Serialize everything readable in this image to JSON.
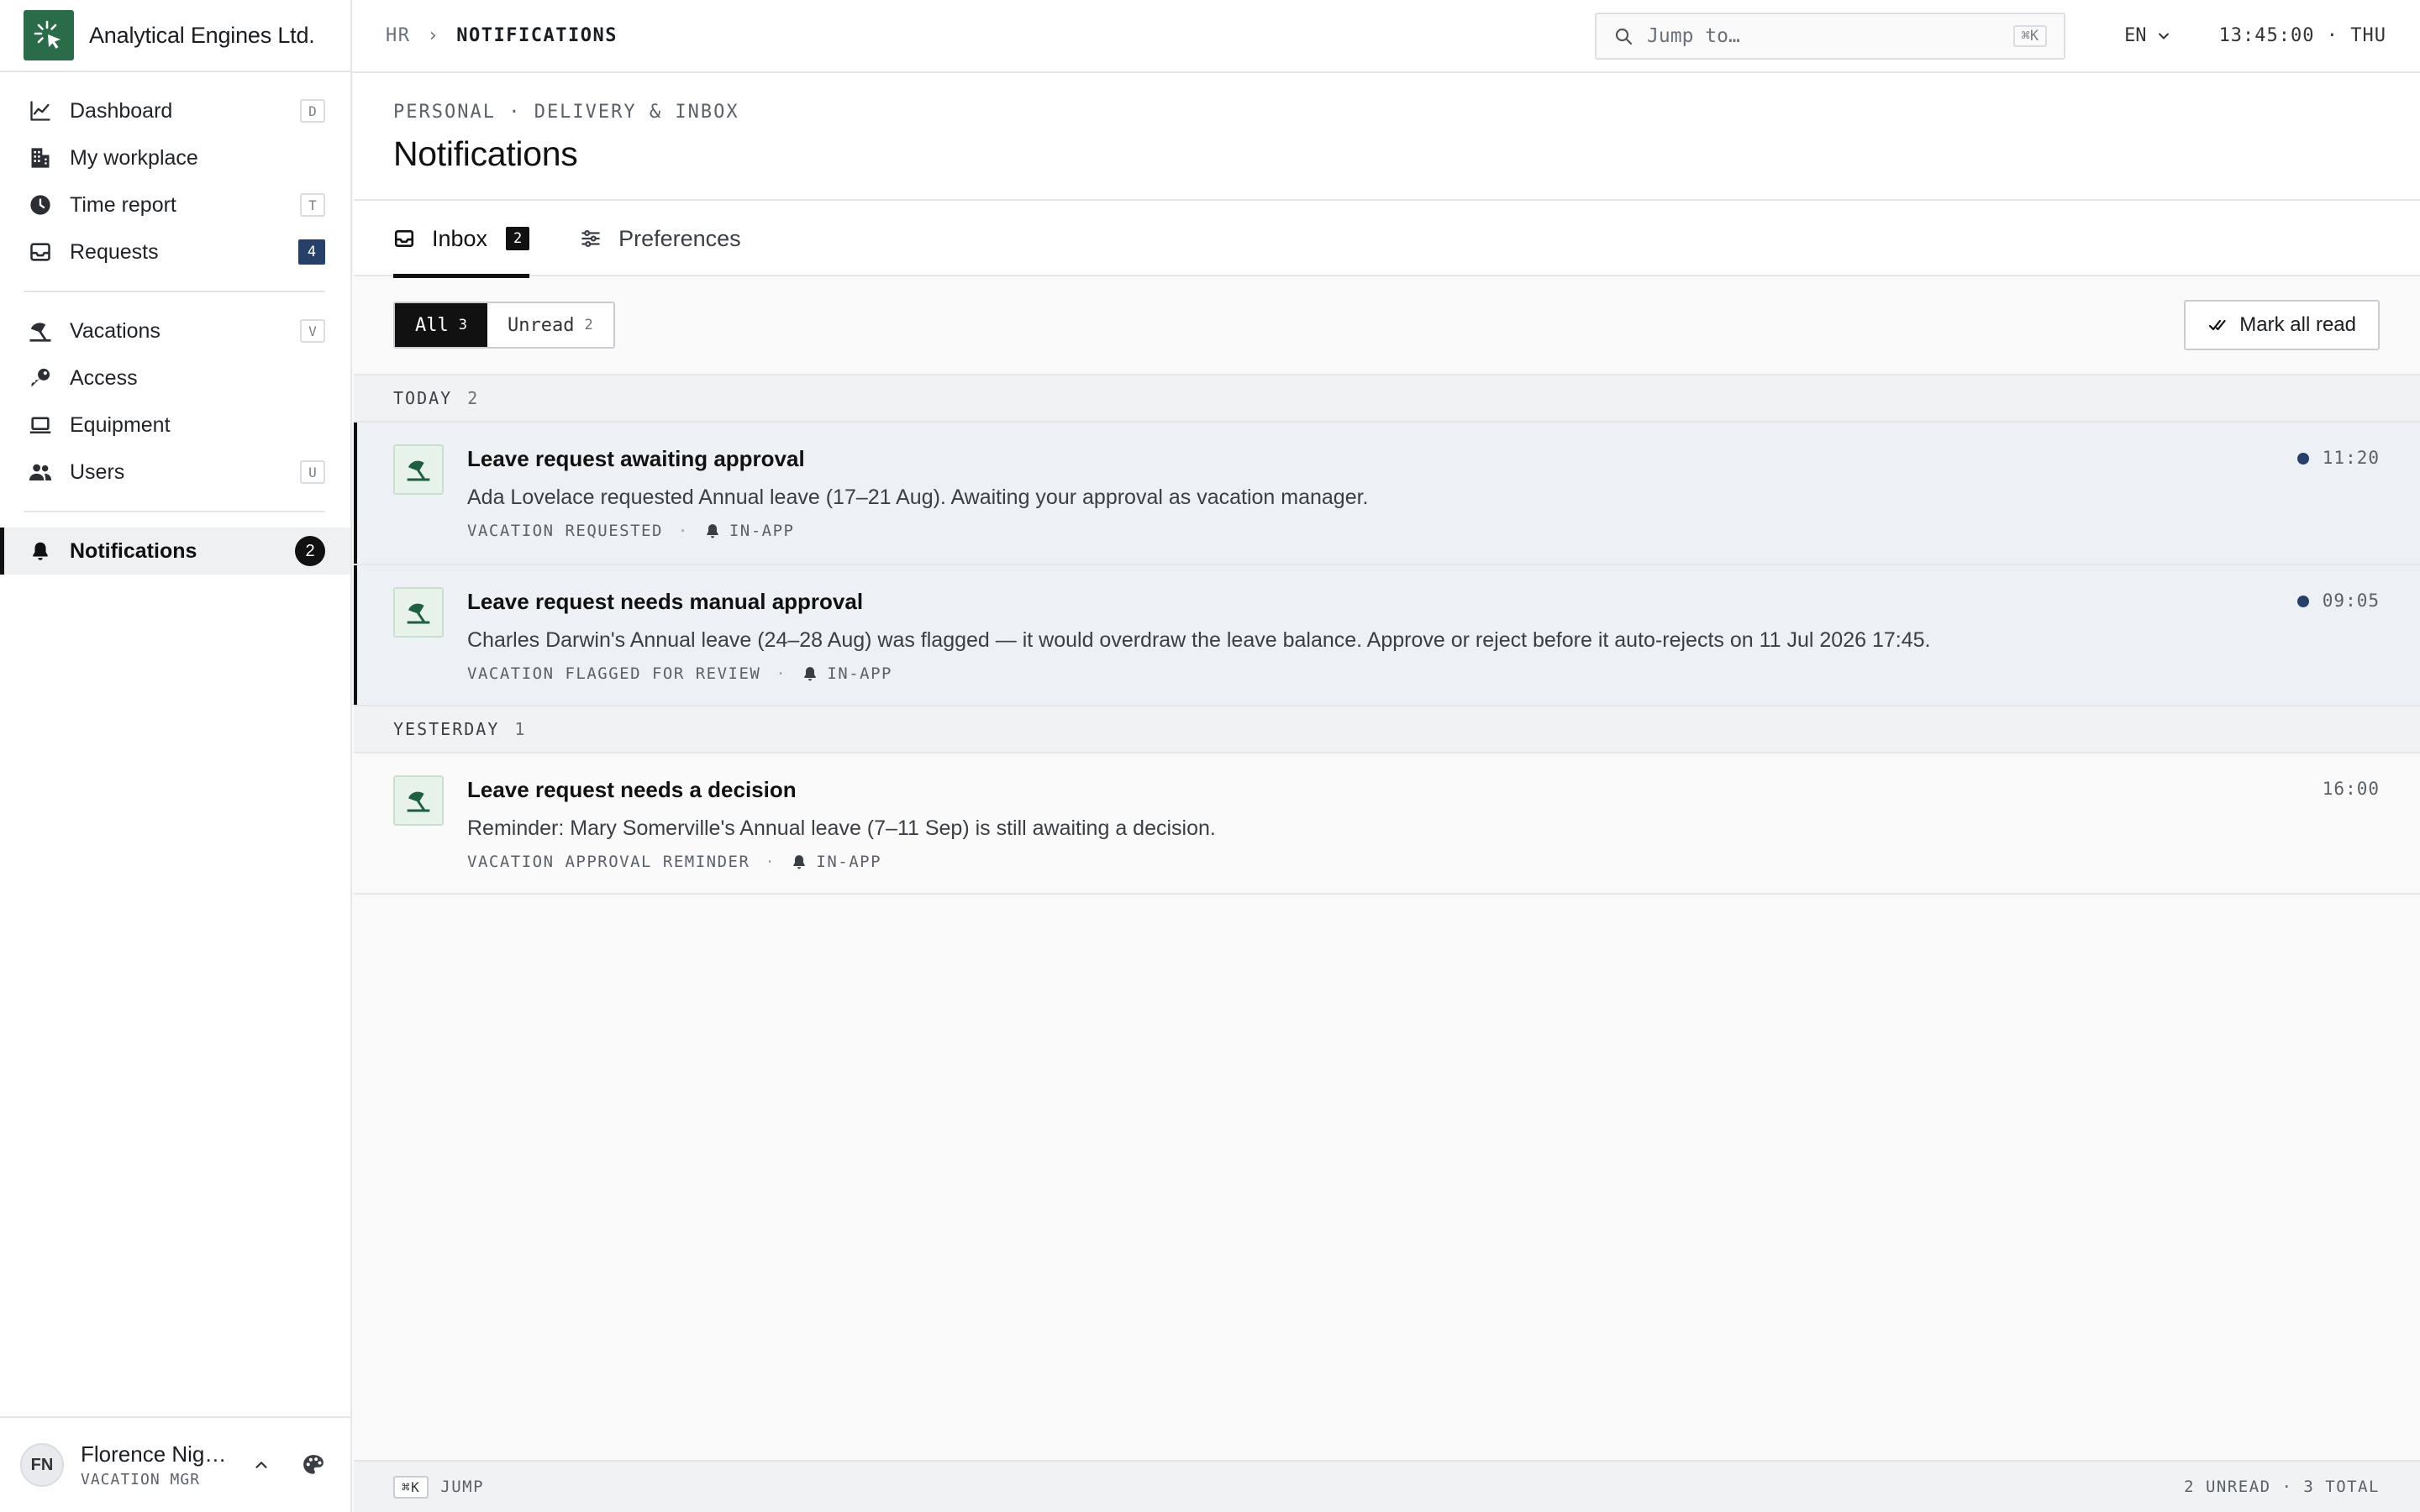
{
  "app": {
    "name": "Analytical Engines Ltd.",
    "logo_icon": "cursor-click-icon"
  },
  "sidebar": {
    "groups": [
      [
        {
          "label": "Dashboard",
          "icon": "chart-line-icon",
          "key": "D"
        },
        {
          "label": "My workplace",
          "icon": "building-icon",
          "key": ""
        },
        {
          "label": "Time report",
          "icon": "clock-icon",
          "key": "T"
        },
        {
          "label": "Requests",
          "icon": "inbox-icon",
          "count": "4"
        }
      ],
      [
        {
          "label": "Vacations",
          "icon": "beach-umbrella-icon",
          "key": "V"
        },
        {
          "label": "Access",
          "icon": "key-icon",
          "key": ""
        },
        {
          "label": "Equipment",
          "icon": "laptop-icon",
          "key": ""
        },
        {
          "label": "Users",
          "icon": "users-icon",
          "key": "U"
        }
      ],
      [
        {
          "label": "Notifications",
          "icon": "bell-icon",
          "pill": "2",
          "active": true
        }
      ]
    ],
    "user": {
      "initials": "FN",
      "name": "Florence Nightingale",
      "role": "VACATION MGR"
    }
  },
  "topbar": {
    "breadcrumb_root": "HR",
    "breadcrumb_sep": "›",
    "breadcrumb_current": "NOTIFICATIONS",
    "search_placeholder": "Jump to…",
    "search_kbd": "⌘K",
    "language": "EN",
    "clock": "13:45:00 · THU"
  },
  "page": {
    "eyebrow": "PERSONAL · DELIVERY & INBOX",
    "title": "Notifications"
  },
  "tabs": [
    {
      "label": "Inbox",
      "count": "2",
      "active": true
    },
    {
      "label": "Preferences",
      "active": false
    }
  ],
  "filters": {
    "all_label": "All",
    "all_count": "3",
    "unread_label": "Unread",
    "unread_count": "2",
    "mark_all_label": "Mark all read"
  },
  "groups": [
    {
      "label": "TODAY",
      "count": "2",
      "items": [
        {
          "title": "Leave request awaiting approval",
          "desc": "Ada Lovelace requested Annual leave (17–21 Aug). Awaiting your approval as vacation manager.",
          "type": "VACATION REQUESTED",
          "channel": "IN-APP",
          "time": "11:20",
          "unread": true
        },
        {
          "title": "Leave request needs manual approval",
          "desc": "Charles Darwin's Annual leave (24–28 Aug) was flagged — it would overdraw the leave balance. Approve or reject before it auto-rejects on 11 Jul 2026 17:45.",
          "type": "VACATION FLAGGED FOR REVIEW",
          "channel": "IN-APP",
          "time": "09:05",
          "unread": true
        }
      ]
    },
    {
      "label": "YESTERDAY",
      "count": "1",
      "items": [
        {
          "title": "Leave request needs a decision",
          "desc": "Reminder: Mary Somerville's Annual leave (7–11 Sep) is still awaiting a decision.",
          "type": "VACATION APPROVAL REMINDER",
          "channel": "IN-APP",
          "time": "16:00",
          "unread": false
        }
      ]
    }
  ],
  "statusbar": {
    "kbd": "⌘K",
    "left": "JUMP",
    "right": "2 UNREAD · 3 TOTAL"
  },
  "colors": {
    "brand": "#2a6b4a",
    "accent": "#27406a",
    "unread_bg": "#edf0f4"
  }
}
